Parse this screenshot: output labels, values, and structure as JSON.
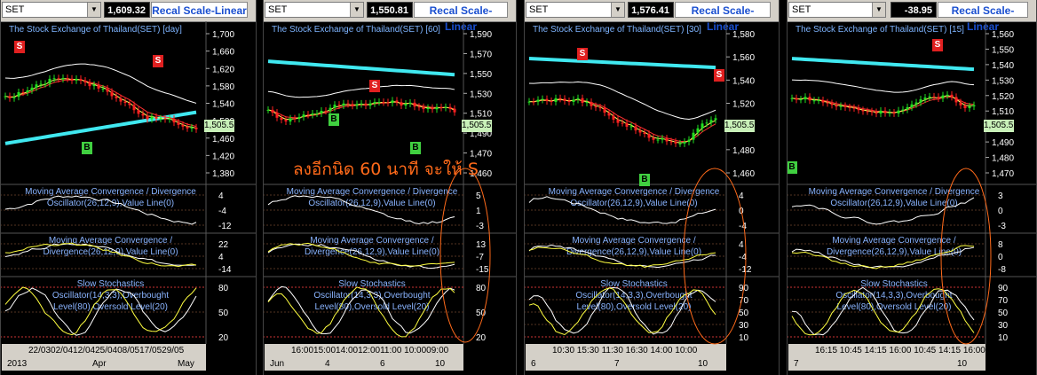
{
  "panes": [
    {
      "symbol": "SET",
      "price": "1,609.32",
      "recal_label": "Recal Scale-Linear",
      "title": "The Stock Exchange of Thailand(SET) [day]",
      "yticks": [
        "1,700",
        "1,660",
        "1,620",
        "1,580",
        "1,540",
        "1,500",
        "1,460",
        "1,420",
        "1,380"
      ],
      "last": "1,505.51",
      "macd1": {
        "title_line1": "Moving Average Convergence / Divergence",
        "title_line2": "Oscillator(26,12,9),Value Line(0)",
        "ticks": [
          "4",
          "-4",
          "-12"
        ]
      },
      "macd2": {
        "title_line1": "Moving Average Convergence /",
        "title_line2": "Divergence(26,12,9),Value Line(0)",
        "ticks": [
          "22",
          "4",
          "-14"
        ]
      },
      "stoch": {
        "title_line1": "Slow Stochastics",
        "title_line2": "Oscillator(14,3,3),Overbought",
        "title_line3": "Level(80),Oversold Level(20)",
        "ticks": [
          "80",
          "50",
          "20"
        ]
      },
      "x_top": "22/0302/0412/0425/0408/0517/0529/05",
      "x_bottom": [
        "2013",
        "Apr",
        "May"
      ],
      "signals": [
        {
          "type": "S",
          "label": "S"
        },
        {
          "type": "B",
          "label": "B"
        },
        {
          "type": "S",
          "label": "S"
        }
      ]
    },
    {
      "symbol": "SET",
      "price": "1,550.81",
      "recal_label": "Recal Scale-Linear",
      "title": "The Stock Exchange of Thailand(SET) [60]",
      "yticks": [
        "1,590",
        "1,570",
        "1,550",
        "1,530",
        "1,510",
        "1,490",
        "1,470",
        "1,460"
      ],
      "last": "1,505.51",
      "macd1": {
        "title_line1": "Moving Average Convergence / Divergence",
        "title_line2": "Oscillator(26,12,9),Value Line(0)",
        "ticks": [
          "5",
          "1",
          "-3"
        ]
      },
      "macd2": {
        "title_line1": "Moving Average Convergence /",
        "title_line2": "Divergence(26,12,9),Value Line(0)",
        "ticks": [
          "13",
          "-7",
          "-15"
        ]
      },
      "stoch": {
        "title_line1": "Slow Stochastics",
        "title_line2": "Oscillator(14,3,3),Overbought",
        "title_line3": "Level(80),Oversold Level(20)",
        "ticks": [
          "80",
          "50",
          "20"
        ]
      },
      "x_top": "16:0015:0014:0012:0011:00 10:0009:00",
      "x_bottom": [
        "Jun",
        "4",
        "6",
        "10"
      ],
      "signals": [
        {
          "type": "B",
          "label": "B"
        },
        {
          "type": "S",
          "label": "S"
        },
        {
          "type": "B",
          "label": "B"
        }
      ]
    },
    {
      "symbol": "SET",
      "price": "1,576.41",
      "recal_label": "Recal Scale-Linear",
      "title": "The Stock Exchange of Thailand(SET) [30]",
      "yticks": [
        "1,580",
        "1,560",
        "1,540",
        "1,520",
        "1,500",
        "1,480",
        "1,460"
      ],
      "last": "1,505.51",
      "macd1": {
        "title_line1": "Moving Average Convergence / Divergence",
        "title_line2": "Oscillator(26,12,9),Value Line(0)",
        "ticks": [
          "4",
          "0",
          "-4"
        ]
      },
      "macd2": {
        "title_line1": "Moving Average Convergence /",
        "title_line2": "Divergence(26,12,9),Value Line(0)",
        "ticks": [
          "4",
          "-4",
          "-12"
        ]
      },
      "stoch": {
        "title_line1": "Slow Stochastics",
        "title_line2": "Oscillator(14,3,3),Overbought",
        "title_line3": "Level(80),Oversold Level(20)",
        "ticks": [
          "90",
          "70",
          "50",
          "30",
          "10"
        ]
      },
      "x_top": "10:30 15:30 11:30 16:30 14:00 10:00",
      "x_bottom": [
        "6",
        "7",
        "10"
      ],
      "signals": [
        {
          "type": "S",
          "label": "S"
        },
        {
          "type": "B",
          "label": "B"
        },
        {
          "type": "S",
          "label": "S"
        }
      ]
    },
    {
      "symbol": "SET",
      "price": "-38.95",
      "recal_label": "Recal Scale-Linear",
      "title": "The Stock Exchange of Thailand(SET) [15]",
      "yticks": [
        "1,560",
        "1,550",
        "1,540",
        "1,530",
        "1,520",
        "1,510",
        "1,500",
        "1,490",
        "1,480",
        "1,470"
      ],
      "last": "1,505.51",
      "macd1": {
        "title_line1": "Moving Average Convergence / Divergence",
        "title_line2": "Oscillator(26,12,9),Value Line(0)",
        "ticks": [
          "3",
          "0",
          "-3"
        ]
      },
      "macd2": {
        "title_line1": "Moving Average Convergence /",
        "title_line2": "Divergence(26,12,9),Value Line(0)",
        "ticks": [
          "8",
          "0",
          "-8"
        ]
      },
      "stoch": {
        "title_line1": "Slow Stochastics",
        "title_line2": "Oscillator(14,3,3),Overbought",
        "title_line3": "Level(80),Oversold Level(20)",
        "ticks": [
          "90",
          "70",
          "50",
          "30",
          "10"
        ]
      },
      "x_top": "16:15 10:45 14:15 16:00 10:45 14:15 16:00",
      "x_bottom": [
        "7",
        "10"
      ],
      "signals": [
        {
          "type": "B",
          "label": "B"
        },
        {
          "type": "S",
          "label": "S"
        }
      ]
    }
  ],
  "annotation": "ลงอีกนิด 60 นาที จะให้ S",
  "colors": {
    "accent_cyan": "#40e8f0",
    "buy": "#40d040",
    "sell": "#e02020",
    "annotation": "#ff6a1a"
  }
}
